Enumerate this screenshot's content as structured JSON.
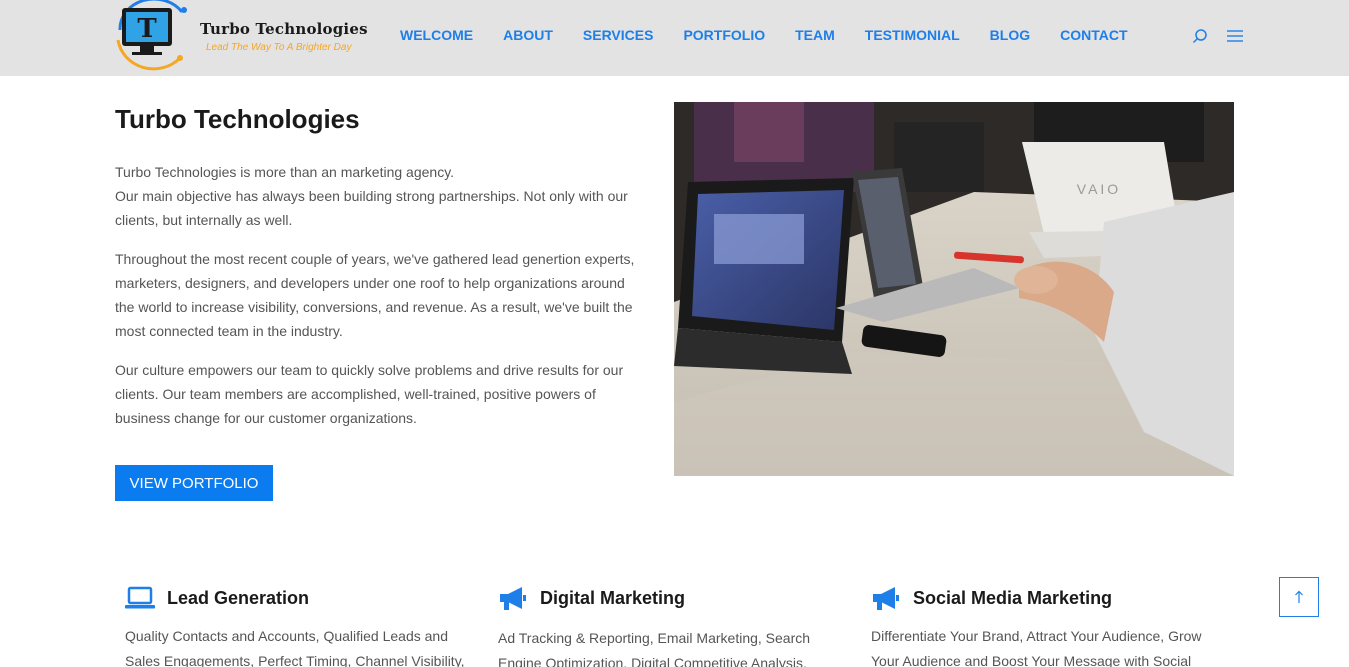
{
  "header": {
    "logo": {
      "title": "Turbo Technologies",
      "tagline": "Lead The Way To A Brighter Day"
    },
    "nav": [
      "WELCOME",
      "ABOUT",
      "SERVICES",
      "PORTFOLIO",
      "TEAM",
      "TESTIMONIAL",
      "BLOG",
      "CONTACT"
    ],
    "icons": [
      "search-icon",
      "hamburger-menu-icon"
    ],
    "accent_color": "#1e7fe8",
    "background_color": "#e3e3e3"
  },
  "about": {
    "title": "Turbo Technologies",
    "paragraph_1_line_1": "Turbo Technologies is more than an marketing agency.",
    "paragraph_1_line_2": "Our main objective has always been building strong partnerships. Not only with our clients, but internally as well.",
    "paragraph_2": "Throughout the most recent couple of years, we've gathered lead genertion experts, marketers, designers, and developers under one roof to help organizations around the world to increase visibility, conversions, and revenue. As a result, we've built the most connected team in the industry.",
    "paragraph_3": "Our culture empowers our team to quickly solve problems and drive results for our clients. Our team members are accomplished, well-trained, positive powers of business change for our customer organizations.",
    "button_label": "VIEW PORTFOLIO",
    "button_color": "#0a7cf0",
    "laptop_brand": "VAIO"
  },
  "services": [
    {
      "icon": "laptop-icon",
      "title": "Lead Generation",
      "text": "Quality Contacts and Accounts, Qualified Leads and Sales Engagements, Perfect Timing, Channel Visibility,"
    },
    {
      "icon": "megaphone-icon",
      "title": "Digital Marketing",
      "text": "Ad Tracking & Reporting, Email Marketing, Search Engine Optimization, Digital Competitive Analysis,"
    },
    {
      "icon": "megaphone-icon",
      "title": "Social Media Marketing",
      "text": "Differentiate Your Brand, Attract Your Audience, Grow Your Audience and Boost Your Message with Social"
    }
  ],
  "scroll_top_icon": "arrow-up-icon"
}
